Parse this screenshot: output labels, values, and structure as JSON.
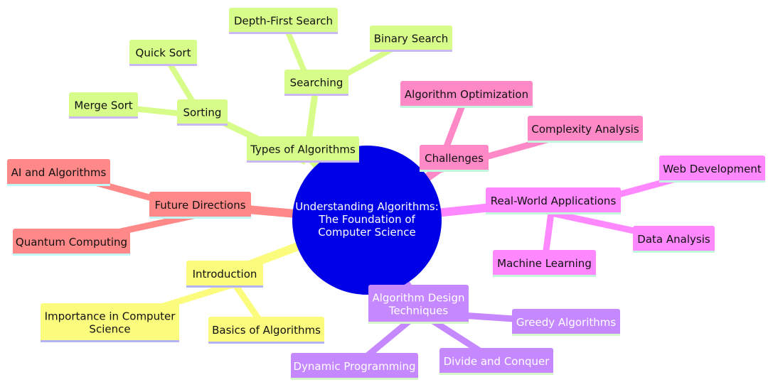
{
  "diagram": {
    "type": "mindmap",
    "root": {
      "id": "root",
      "lines": [
        "Understanding Algorithms:",
        "The Foundation of",
        "Computer Science"
      ],
      "color": "#0000e6",
      "text_color": "#ffffff"
    },
    "branches": [
      {
        "id": "types",
        "label": [
          "Types of Algorithms"
        ],
        "color": "#d7fc8a",
        "text_color": "#111111",
        "underline": "#c9b8f5",
        "children": [
          {
            "id": "sorting",
            "label": [
              "Sorting"
            ],
            "children": [
              {
                "id": "quick-sort",
                "label": [
                  "Quick Sort"
                ]
              },
              {
                "id": "merge-sort",
                "label": [
                  "Merge Sort"
                ]
              }
            ]
          },
          {
            "id": "searching",
            "label": [
              "Searching"
            ],
            "children": [
              {
                "id": "dfs",
                "label": [
                  "Depth-First Search"
                ]
              },
              {
                "id": "binary-search",
                "label": [
                  "Binary Search"
                ]
              }
            ]
          }
        ]
      },
      {
        "id": "challenges",
        "label": [
          "Challenges"
        ],
        "color": "#ff88c6",
        "text_color": "#111111",
        "underline": "#c2f7de",
        "children": [
          {
            "id": "optimization",
            "label": [
              "Algorithm Optimization"
            ]
          },
          {
            "id": "complexity",
            "label": [
              "Complexity Analysis"
            ]
          }
        ]
      },
      {
        "id": "applications",
        "label": [
          "Real-World Applications"
        ],
        "color": "#ff88ff",
        "text_color": "#111111",
        "underline": "#c2f7de",
        "children": [
          {
            "id": "web-dev",
            "label": [
              "Web Development"
            ]
          },
          {
            "id": "data-analysis",
            "label": [
              "Data Analysis"
            ]
          },
          {
            "id": "ml",
            "label": [
              "Machine Learning"
            ]
          }
        ]
      },
      {
        "id": "design",
        "label": [
          "Algorithm Design",
          "Techniques"
        ],
        "color": "#c588ff",
        "text_color": "#ffffff",
        "underline": "#d6f7c9",
        "children": [
          {
            "id": "greedy",
            "label": [
              "Greedy Algorithms"
            ]
          },
          {
            "id": "divide",
            "label": [
              "Divide and Conquer"
            ]
          },
          {
            "id": "dynamic",
            "label": [
              "Dynamic Programming"
            ]
          }
        ]
      },
      {
        "id": "intro",
        "label": [
          "Introduction"
        ],
        "color": "#fbfb7e",
        "text_color": "#111111",
        "underline": "#b3b3f5",
        "children": [
          {
            "id": "importance",
            "label": [
              "Importance in Computer",
              "Science"
            ]
          },
          {
            "id": "basics",
            "label": [
              "Basics of Algorithms"
            ]
          }
        ]
      },
      {
        "id": "future",
        "label": [
          "Future Directions"
        ],
        "color": "#ff8888",
        "text_color": "#111111",
        "underline": "#c2f7f7",
        "children": [
          {
            "id": "ai",
            "label": [
              "AI and Algorithms"
            ]
          },
          {
            "id": "quantum",
            "label": [
              "Quantum Computing"
            ]
          }
        ]
      }
    ]
  }
}
